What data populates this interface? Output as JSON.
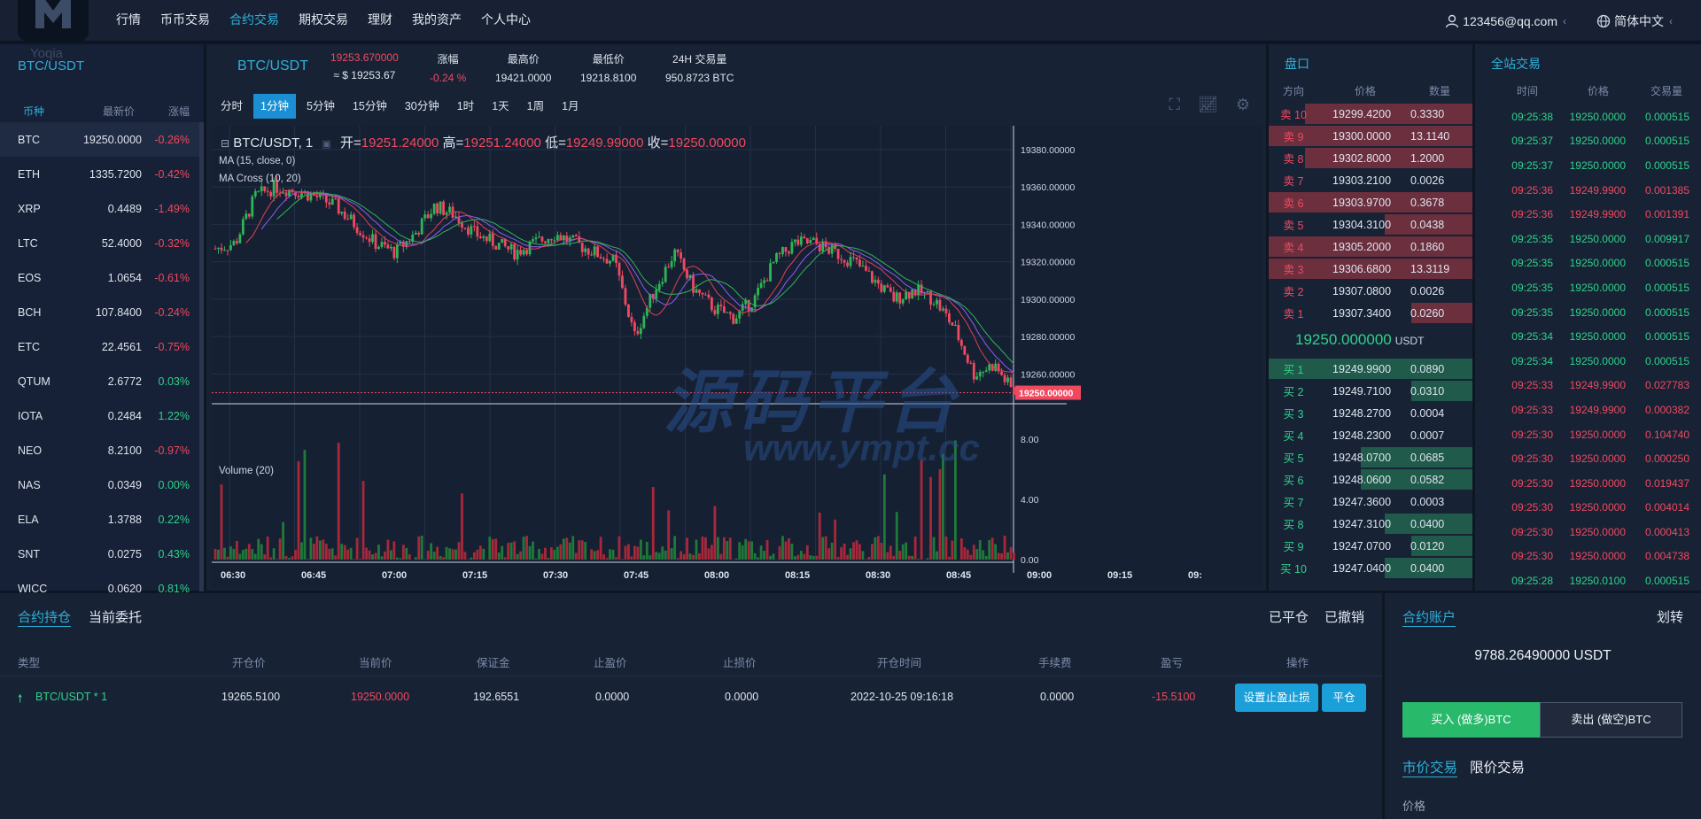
{
  "nav": {
    "logo_word": "Yoqia",
    "items": [
      "行情",
      "币币交易",
      "合约交易",
      "期权交易",
      "理财",
      "我的资产",
      "个人中心"
    ],
    "active_index": 2,
    "user": "123456@qq.com",
    "language": "简体中文"
  },
  "market": {
    "title": "BTC/USDT",
    "headers": [
      "币种",
      "最新价",
      "涨幅"
    ],
    "rows": [
      {
        "sym": "BTC",
        "price": "19250.0000",
        "chg": "-0.26%",
        "dir": "neg"
      },
      {
        "sym": "ETH",
        "price": "1335.7200",
        "chg": "-0.42%",
        "dir": "neg"
      },
      {
        "sym": "XRP",
        "price": "0.4489",
        "chg": "-1.49%",
        "dir": "neg"
      },
      {
        "sym": "LTC",
        "price": "52.4000",
        "chg": "-0.32%",
        "dir": "neg"
      },
      {
        "sym": "EOS",
        "price": "1.0654",
        "chg": "-0.61%",
        "dir": "neg"
      },
      {
        "sym": "BCH",
        "price": "107.8400",
        "chg": "-0.24%",
        "dir": "neg"
      },
      {
        "sym": "ETC",
        "price": "22.4561",
        "chg": "-0.75%",
        "dir": "neg"
      },
      {
        "sym": "QTUM",
        "price": "2.6772",
        "chg": "0.03%",
        "dir": "pos"
      },
      {
        "sym": "IOTA",
        "price": "0.2484",
        "chg": "1.22%",
        "dir": "pos"
      },
      {
        "sym": "NEO",
        "price": "8.2100",
        "chg": "-0.97%",
        "dir": "neg"
      },
      {
        "sym": "NAS",
        "price": "0.0349",
        "chg": "0.00%",
        "dir": "pos"
      },
      {
        "sym": "ELA",
        "price": "1.3788",
        "chg": "0.22%",
        "dir": "pos"
      },
      {
        "sym": "SNT",
        "price": "0.0275",
        "chg": "0.43%",
        "dir": "pos"
      },
      {
        "sym": "WICC",
        "price": "0.0620",
        "chg": "0.81%",
        "dir": "pos"
      }
    ]
  },
  "chart_header": {
    "pair": "BTC/USDT",
    "price": "19253.670000",
    "price_usd": "≈ $ 19253.67",
    "change_label": "涨幅",
    "change": "-0.24 %",
    "high_label": "最高价",
    "high": "19421.0000",
    "low_label": "最低价",
    "low": "19218.8100",
    "vol_label": "24H 交易量",
    "vol": "950.8723 BTC"
  },
  "intervals": [
    "分时",
    "1分钟",
    "5分钟",
    "15分钟",
    "30分钟",
    "1时",
    "1天",
    "1周",
    "1月"
  ],
  "active_interval": 1,
  "chart_legend": {
    "symbol": "BTC/USDT, 1",
    "open_label": "开=",
    "open": "19251.24000",
    "high_label": "高=",
    "high": "19251.24000",
    "low_label": "低=",
    "low": "19249.99000",
    "close_label": "收=",
    "close": "19250.00000",
    "ind1": "MA (15, close, 0)",
    "ind2": "MA Cross (10, 20)",
    "volume": "Volume (20)"
  },
  "watermark": {
    "cn": "源码平台",
    "url": "www.ympt.cc"
  },
  "chart_data": {
    "type": "line",
    "x": [
      "06:30",
      "06:45",
      "07:00",
      "07:15",
      "07:30",
      "07:45",
      "08:00",
      "08:15",
      "08:30",
      "08:45",
      "09:00",
      "09:15",
      "09:"
    ],
    "price_axis": [
      "19380.00000",
      "19360.00000",
      "19340.00000",
      "19320.00000",
      "19300.00000",
      "19280.00000",
      "19260.00000"
    ],
    "current_price_label": "19250.00000",
    "ylim": [
      19246,
      19388
    ],
    "volume_axis": [
      "8.00",
      "4.00",
      "0.00"
    ],
    "volume_ylim": [
      0,
      10
    ],
    "series": [
      {
        "values": [
          19327,
          19330,
          19355,
          19360,
          19358,
          19355,
          19350,
          19340,
          19330,
          19325,
          19335,
          19350,
          19345,
          19335,
          19330,
          19325,
          19330,
          19335,
          19330,
          19325,
          19320,
          19280,
          19305,
          19325,
          19305,
          19295,
          19290,
          19300,
          19320,
          19330,
          19330,
          19325,
          19320,
          19310,
          19300,
          19305,
          19300,
          19285,
          19260,
          19265,
          19250
        ]
      }
    ]
  },
  "orderbook": {
    "title": "盘口",
    "headers": [
      "方向",
      "价格",
      "数量"
    ],
    "asks": [
      {
        "side": "卖 10",
        "price": "19299.4200",
        "qty": "0.3330",
        "depth": 0.82
      },
      {
        "side": "卖 9",
        "price": "19300.0000",
        "qty": "13.1140",
        "depth": 1.0
      },
      {
        "side": "卖 8",
        "price": "19302.8000",
        "qty": "1.2000",
        "depth": 0.82
      },
      {
        "side": "卖 7",
        "price": "19303.2100",
        "qty": "0.0026",
        "depth": 0.0
      },
      {
        "side": "卖 6",
        "price": "19303.9700",
        "qty": "0.3678",
        "depth": 1.0
      },
      {
        "side": "卖 5",
        "price": "19304.3100",
        "qty": "0.0438",
        "depth": 0.43
      },
      {
        "side": "卖 4",
        "price": "19305.2000",
        "qty": "0.1860",
        "depth": 1.0
      },
      {
        "side": "卖 3",
        "price": "19306.6800",
        "qty": "13.3119",
        "depth": 1.0
      },
      {
        "side": "卖 2",
        "price": "19307.0800",
        "qty": "0.0026",
        "depth": 0.0
      },
      {
        "side": "卖 1",
        "price": "19307.3400",
        "qty": "0.0260",
        "depth": 0.3
      }
    ],
    "last": "19250.000000",
    "last_unit": "USDT",
    "bids": [
      {
        "side": "买 1",
        "price": "19249.9900",
        "qty": "0.0890",
        "depth": 1.0
      },
      {
        "side": "买 2",
        "price": "19249.7100",
        "qty": "0.0310",
        "depth": 0.3
      },
      {
        "side": "买 3",
        "price": "19248.2700",
        "qty": "0.0004",
        "depth": 0.0
      },
      {
        "side": "买 4",
        "price": "19248.2300",
        "qty": "0.0007",
        "depth": 0.0
      },
      {
        "side": "买 5",
        "price": "19248.0700",
        "qty": "0.0685",
        "depth": 0.55
      },
      {
        "side": "买 6",
        "price": "19248.0600",
        "qty": "0.0582",
        "depth": 0.55
      },
      {
        "side": "买 7",
        "price": "19247.3600",
        "qty": "0.0003",
        "depth": 0.0
      },
      {
        "side": "买 8",
        "price": "19247.3100",
        "qty": "0.0400",
        "depth": 0.43
      },
      {
        "side": "买 9",
        "price": "19247.0700",
        "qty": "0.0120",
        "depth": 0.3
      },
      {
        "side": "买 10",
        "price": "19247.0400",
        "qty": "0.0400",
        "depth": 0.43
      }
    ]
  },
  "trades": {
    "title": "全站交易",
    "headers": [
      "时间",
      "价格",
      "交易量"
    ],
    "rows": [
      {
        "t": "09:25:38",
        "p": "19250.0000",
        "q": "0.000515",
        "dir": "pos"
      },
      {
        "t": "09:25:37",
        "p": "19250.0000",
        "q": "0.000515",
        "dir": "pos"
      },
      {
        "t": "09:25:37",
        "p": "19250.0000",
        "q": "0.000515",
        "dir": "pos"
      },
      {
        "t": "09:25:36",
        "p": "19249.9900",
        "q": "0.001385",
        "dir": "neg"
      },
      {
        "t": "09:25:36",
        "p": "19249.9900",
        "q": "0.001391",
        "dir": "neg"
      },
      {
        "t": "09:25:35",
        "p": "19250.0000",
        "q": "0.009917",
        "dir": "pos"
      },
      {
        "t": "09:25:35",
        "p": "19250.0000",
        "q": "0.000515",
        "dir": "pos"
      },
      {
        "t": "09:25:35",
        "p": "19250.0000",
        "q": "0.000515",
        "dir": "pos"
      },
      {
        "t": "09:25:35",
        "p": "19250.0000",
        "q": "0.000515",
        "dir": "pos"
      },
      {
        "t": "09:25:34",
        "p": "19250.0000",
        "q": "0.000515",
        "dir": "pos"
      },
      {
        "t": "09:25:34",
        "p": "19250.0000",
        "q": "0.000515",
        "dir": "pos"
      },
      {
        "t": "09:25:33",
        "p": "19249.9900",
        "q": "0.027783",
        "dir": "neg"
      },
      {
        "t": "09:25:33",
        "p": "19249.9900",
        "q": "0.000382",
        "dir": "neg"
      },
      {
        "t": "09:25:30",
        "p": "19250.0000",
        "q": "0.104740",
        "dir": "neg"
      },
      {
        "t": "09:25:30",
        "p": "19250.0000",
        "q": "0.000250",
        "dir": "neg"
      },
      {
        "t": "09:25:30",
        "p": "19250.0000",
        "q": "0.019437",
        "dir": "neg"
      },
      {
        "t": "09:25:30",
        "p": "19250.0000",
        "q": "0.004014",
        "dir": "neg"
      },
      {
        "t": "09:25:30",
        "p": "19250.0000",
        "q": "0.000413",
        "dir": "neg"
      },
      {
        "t": "09:25:30",
        "p": "19250.0000",
        "q": "0.004738",
        "dir": "neg"
      },
      {
        "t": "09:25:28",
        "p": "19250.0100",
        "q": "0.000515",
        "dir": "pos"
      }
    ]
  },
  "positions": {
    "tabs": [
      "合约持仓",
      "当前委托"
    ],
    "right_tabs": [
      "已平仓",
      "已撤销"
    ],
    "headers": [
      "类型",
      "开仓价",
      "当前价",
      "保证金",
      "止盈价",
      "止损价",
      "开仓时间",
      "手续费",
      "盈亏",
      "操作"
    ],
    "row": {
      "type": "BTC/USDT * 1",
      "open": "19265.5100",
      "current": "19250.0000",
      "margin": "192.6551",
      "tp": "0.0000",
      "sl": "0.0000",
      "time": "2022-10-25 09:16:18",
      "fee": "0.0000",
      "pnl": "-15.5100"
    },
    "btn_set": "设置止盈止损",
    "btn_close": "平仓"
  },
  "account": {
    "title": "合约账户",
    "transfer": "划转",
    "balance": "9788.26490000 USDT",
    "buy": "买入 (做多)BTC",
    "sell": "卖出 (做空)BTC",
    "tabs": [
      "市价交易",
      "限价交易"
    ],
    "price_label": "价格"
  },
  "colors": {
    "up": "#2fd28a",
    "down": "#f0495f",
    "accent": "#2fb0d8"
  }
}
